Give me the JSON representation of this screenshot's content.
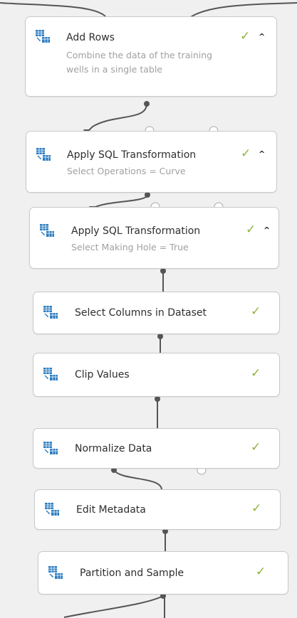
{
  "colors": {
    "background": "#f0f0f0",
    "node_border": "#c9c9c9",
    "check": "#8bb53a",
    "wire": "#555555",
    "icon_blue": "#2c7cc1"
  },
  "nodes": [
    {
      "title": "Add Rows",
      "subtitle": "Combine the data of the training wells in a single table",
      "status_icon": "check-icon",
      "collapse_icon": "caret-up-icon"
    },
    {
      "title": "Apply SQL Transformation",
      "subtitle": "Select Operations = Curve",
      "status_icon": "check-icon",
      "collapse_icon": "caret-up-icon"
    },
    {
      "title": "Apply SQL Transformation",
      "subtitle": "Select Making Hole = True",
      "status_icon": "check-icon",
      "collapse_icon": "caret-up-icon"
    },
    {
      "title": "Select Columns in Dataset",
      "status_icon": "check-icon"
    },
    {
      "title": "Clip Values",
      "status_icon": "check-icon"
    },
    {
      "title": "Normalize Data",
      "status_icon": "check-icon"
    },
    {
      "title": "Edit Metadata",
      "status_icon": "check-icon"
    },
    {
      "title": "Partition and Sample",
      "status_icon": "check-icon"
    }
  ],
  "glyphs": {
    "check": "✓",
    "caret_up": "^"
  }
}
